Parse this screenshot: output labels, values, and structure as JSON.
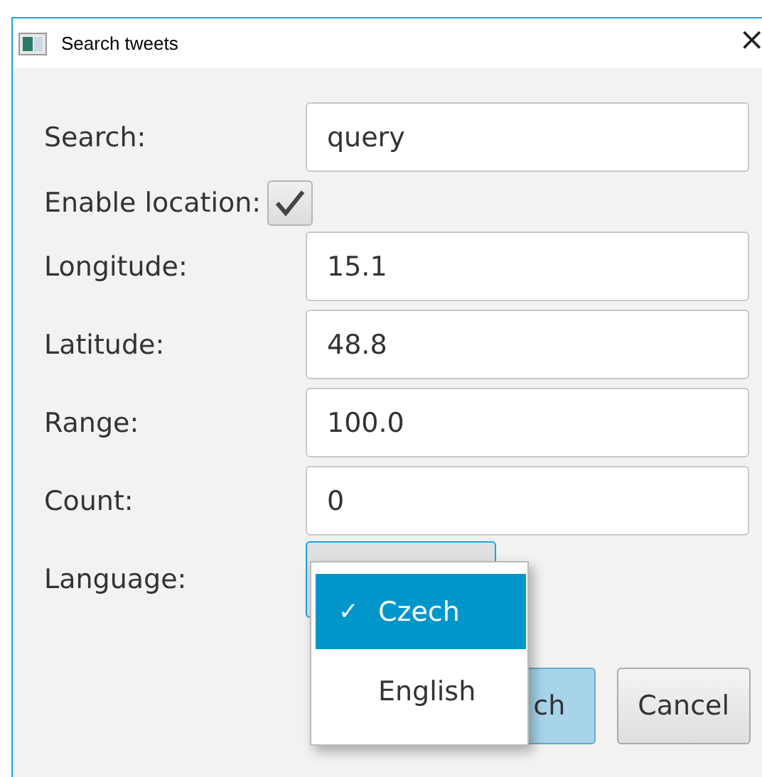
{
  "window": {
    "title": "Search tweets",
    "close": "×"
  },
  "form": [
    {
      "kind": "text",
      "label": "Search:",
      "value": "query"
    },
    {
      "kind": "checkbox",
      "label": "Enable location:",
      "checked": true
    },
    {
      "kind": "text",
      "label": "Longitude:",
      "value": "15.1"
    },
    {
      "kind": "text",
      "label": "Latitude:",
      "value": "48.8"
    },
    {
      "kind": "text",
      "label": "Range:",
      "value": "100.0"
    },
    {
      "kind": "text",
      "label": "Count:",
      "value": "0"
    },
    {
      "kind": "combo",
      "label": "Language:"
    }
  ],
  "dropdown": {
    "check": "✓",
    "options": [
      {
        "label": "Czech",
        "selected": true
      },
      {
        "label": "English",
        "selected": false
      }
    ]
  },
  "buttons": [
    {
      "label": "ch",
      "kind": "default"
    },
    {
      "label": "Cancel",
      "kind": "normal"
    }
  ]
}
